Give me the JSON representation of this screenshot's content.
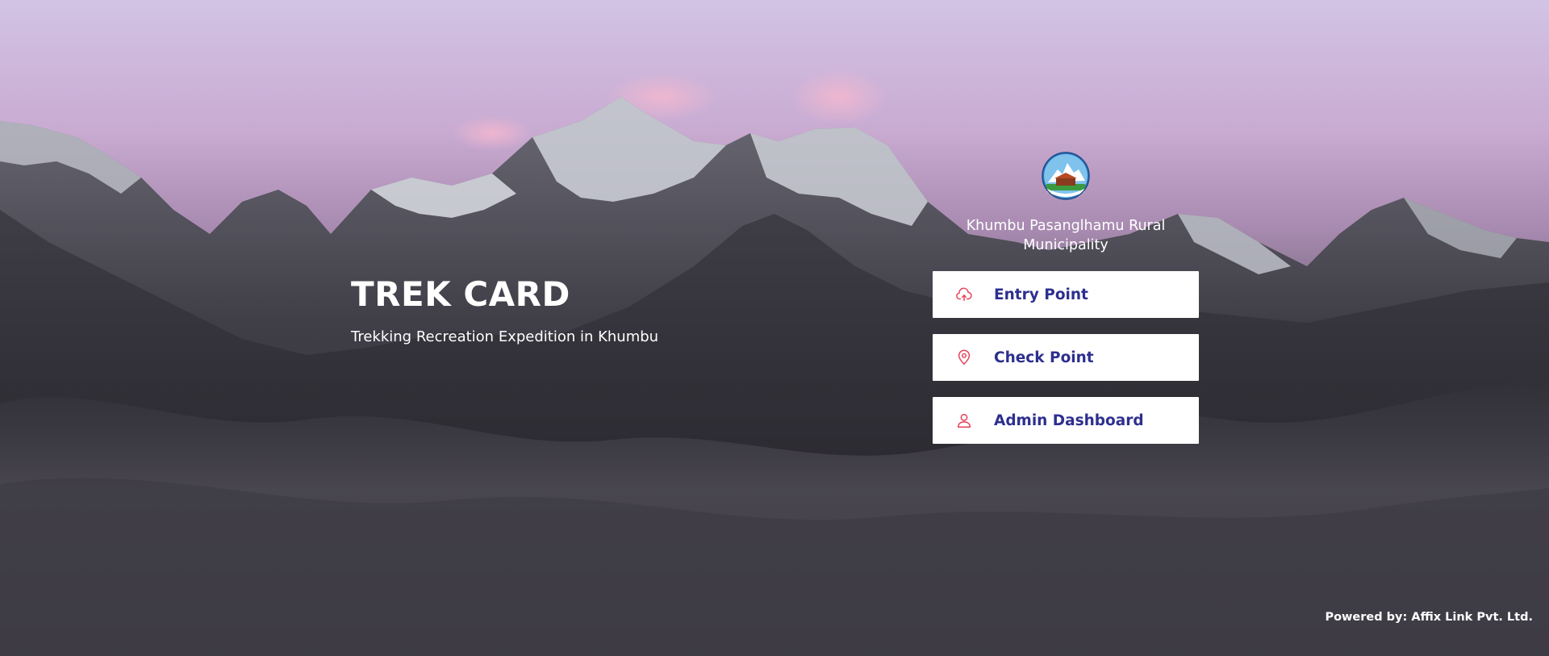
{
  "brand": {
    "title": "TREK CARD",
    "subtitle": "Trekking Recreation Expedition in Khumbu"
  },
  "municipality": {
    "name": "Khumbu Pasanglhamu Rural Municipality",
    "logo_icon": "municipality-emblem"
  },
  "nav": {
    "items": [
      {
        "label": "Entry Point",
        "icon": "cloud-upload-icon"
      },
      {
        "label": "Check Point",
        "icon": "map-pin-icon"
      },
      {
        "label": "Admin Dashboard",
        "icon": "user-icon"
      }
    ]
  },
  "footer": {
    "powered_by": "Powered by: Affix Link Pvt. Ltd."
  },
  "colors": {
    "button_text": "#2d2f8f",
    "icon_accent": "#e8405a",
    "button_bg": "#ffffff"
  }
}
